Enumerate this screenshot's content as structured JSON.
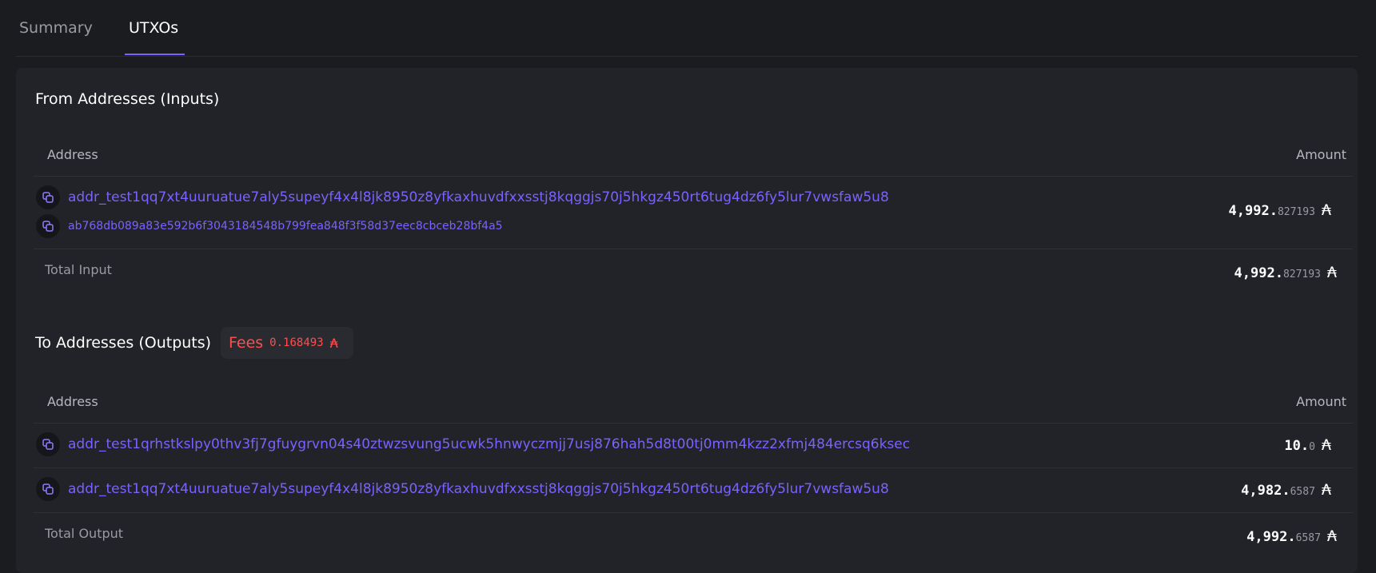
{
  "tabs": [
    {
      "label": "Summary"
    },
    {
      "label": "UTXOs"
    }
  ],
  "inputs": {
    "title": "From Addresses (Inputs)",
    "col_address": "Address",
    "col_amount": "Amount",
    "rows": [
      {
        "address": "addr_test1qq7xt4uuruatue7aly5supeyf4x4l8jk8950z8yfkaxhuvdfxxsstj8kqggjs70j5hkgz450rt6tug4dz6fy5lur7vwsfaw5u8",
        "tx_hash": "ab768db089a83e592b6f3043184548b799fea848f3f58d37eec8cbceb28bf4a5",
        "amount_int": "4,992.",
        "amount_dec": "827193"
      }
    ],
    "total_label": "Total Input",
    "total_int": "4,992.",
    "total_dec": "827193"
  },
  "outputs": {
    "title": "To Addresses (Outputs)",
    "fees_label": "Fees",
    "fees_amount": "0.168493",
    "col_address": "Address",
    "col_amount": "Amount",
    "rows": [
      {
        "address": "addr_test1qrhstkslpy0thv3fj7gfuygrvn04s40ztwzsvung5ucwk5hnwyczmjj7usj876hah5d8t00tj0mm4kzz2xfmj484ercsq6ksec",
        "amount_int": "10.",
        "amount_dec": "0"
      },
      {
        "address": "addr_test1qq7xt4uuruatue7aly5supeyf4x4l8jk8950z8yfkaxhuvdfxxsstj8kqggjs70j5hkgz450rt6tug4dz6fy5lur7vwsfaw5u8",
        "amount_int": "4,982.",
        "amount_dec": "6587"
      }
    ],
    "total_label": "Total Output",
    "total_int": "4,992.",
    "total_dec": "6587"
  },
  "ada_symbol": "₳",
  "icons": {
    "copy": "copy-icon"
  },
  "colors": {
    "accent": "#7b61ff",
    "fees": "#ff4d4f"
  }
}
